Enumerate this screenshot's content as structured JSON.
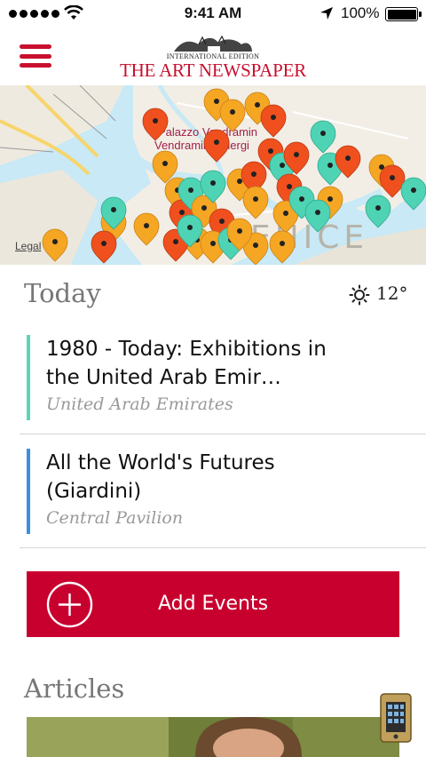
{
  "status_bar": {
    "time": "9:41 AM",
    "battery_percent": "100%",
    "icons": [
      "signal-dots-icon",
      "wifi-icon",
      "location-arrow-icon",
      "battery-icon"
    ]
  },
  "header": {
    "menu_icon": "hamburger-menu-icon",
    "logo": {
      "edition": "INTERNATIONAL EDITION",
      "title": "THE ART NEWSPAPER"
    }
  },
  "map": {
    "labels": [
      "Palazzo Vendramin Calergi",
      "ENICE"
    ],
    "legal": "Legal",
    "pin_colors": {
      "orange": "#f5a623",
      "red": "#f0501e",
      "teal": "#4ed4b4"
    }
  },
  "today": {
    "heading": "Today",
    "weather_icon": "sun-icon",
    "temperature": "12°",
    "events": [
      {
        "title": "1980 - Today: Exhibitions in the United Arab Emir…",
        "venue": "United Arab Emirates",
        "accent": "#5cd6b8"
      },
      {
        "title": "All the World's Futures (Giardini)",
        "venue": "Central Pavilion",
        "accent": "#3a8ee6"
      }
    ]
  },
  "add_events": {
    "label": "Add Events",
    "icon": "plus-circle-icon",
    "color": "#c8002e"
  },
  "articles": {
    "heading": "Articles"
  },
  "colors": {
    "brand_red": "#c8102e",
    "heading_gray": "#777777",
    "venue_gray": "#999999"
  }
}
